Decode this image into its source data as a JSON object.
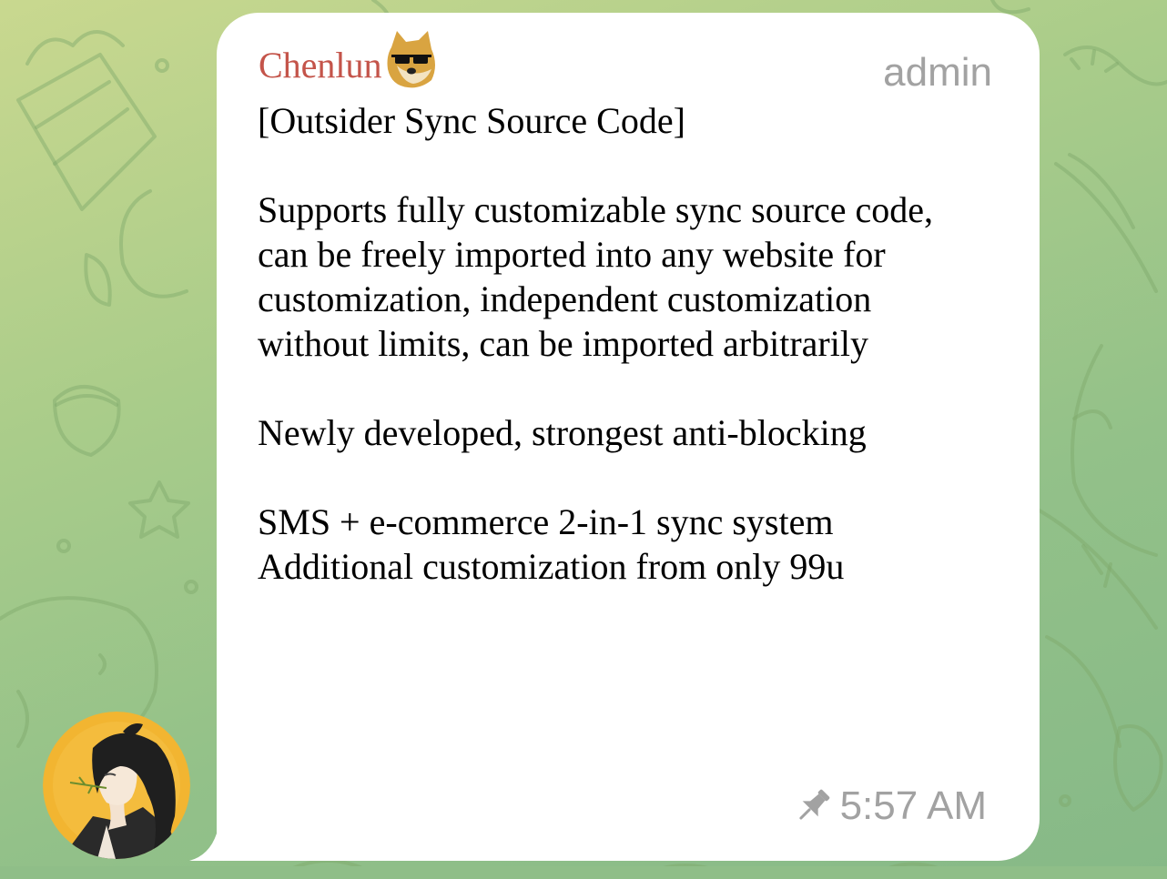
{
  "message": {
    "sender_name": "Chenlun",
    "sender_badge_icon": "doge-sunglasses-icon",
    "role_label": "admin",
    "paragraphs": [
      [
        "[Outsider Sync Source Code]"
      ],
      [
        "Supports fully customizable sync source code,",
        "can be freely imported into any website for",
        "customization, independent customization",
        "without limits, can be imported arbitrarily"
      ],
      [
        "Newly developed, strongest anti-blocking"
      ],
      [
        "SMS + e-commerce 2-in-1 sync system",
        "Additional customization from only 99u"
      ]
    ],
    "pinned_icon": "pin-icon",
    "time": "5:57 AM"
  },
  "colors": {
    "sender_name": "#c4544a",
    "meta_text": "#a2a2a2",
    "bubble": "#ffffff",
    "background": "#9cc68a"
  },
  "avatar": {
    "icon": "avatar-illustration",
    "background_color": "#f2b531"
  }
}
